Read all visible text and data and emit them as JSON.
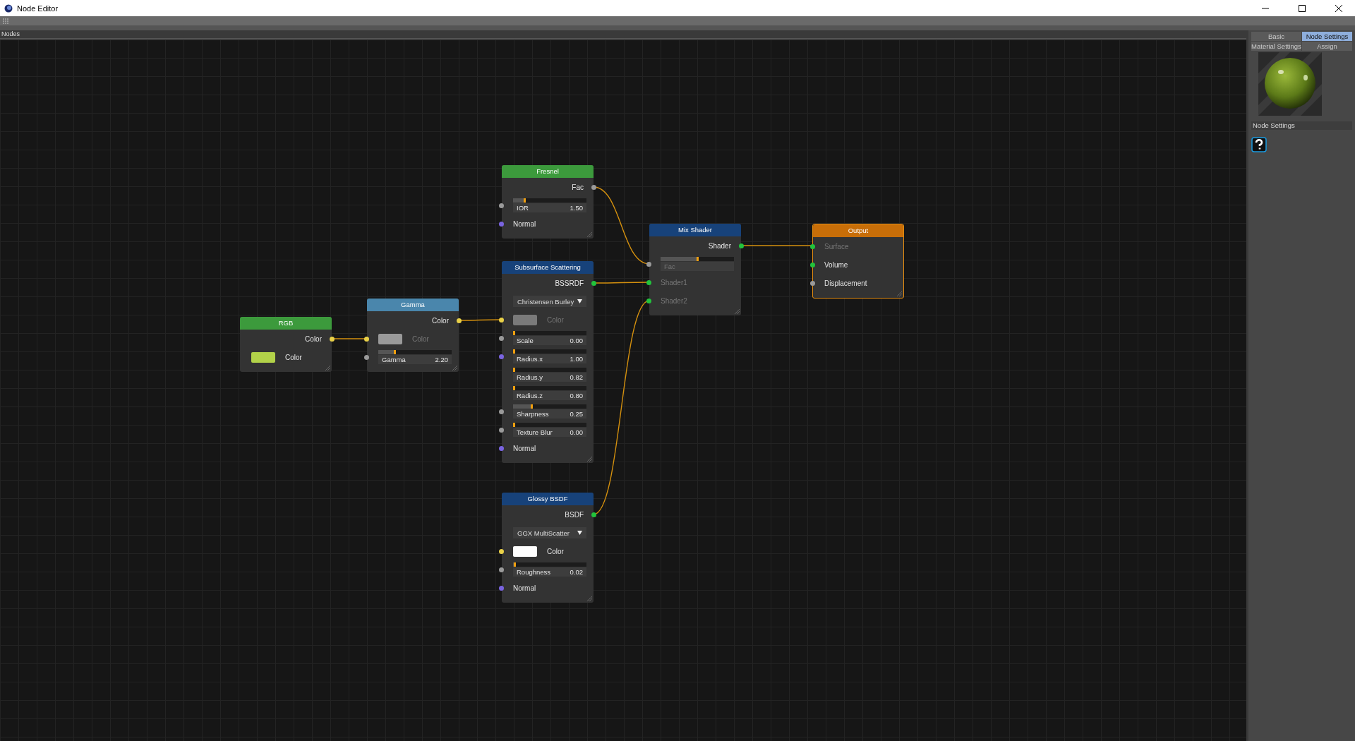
{
  "window": {
    "title": "Node Editor"
  },
  "editor": {
    "title": "Nodes"
  },
  "nodes": [
    {
      "title": "Fresnel",
      "kind": "input",
      "rows": [
        {
          "kind": "output",
          "label": "Fac",
          "socket": {
            "kind": "float"
          }
        },
        {
          "kind": "slider",
          "label": "IOR",
          "value": "1.50",
          "level": 0.15,
          "socket": {
            "kind": "float"
          },
          "connected": false
        },
        {
          "kind": "input",
          "label": "Normal",
          "socket": {
            "kind": "vector"
          },
          "connected": false
        }
      ]
    },
    {
      "title": "Mix Shader",
      "kind": "shader",
      "rows": [
        {
          "kind": "output",
          "label": "Shader",
          "socket": {
            "kind": "shader"
          }
        },
        {
          "kind": "slider",
          "label": "Fac",
          "level": 0.5,
          "socket": {
            "kind": "float"
          },
          "connected": true
        },
        {
          "kind": "input",
          "label": "Shader1",
          "socket": {
            "kind": "shader"
          },
          "connected": true
        },
        {
          "kind": "input",
          "label": "Shader2",
          "socket": {
            "kind": "shader"
          },
          "connected": true
        }
      ]
    },
    {
      "title": "Output",
      "kind": "output",
      "rows": [
        {
          "kind": "input",
          "label": "Surface",
          "socket": {
            "kind": "shader"
          },
          "connected": true
        },
        {
          "kind": "input",
          "label": "Volume",
          "socket": {
            "kind": "shader"
          },
          "connected": false
        },
        {
          "kind": "input",
          "label": "Displacement",
          "socket": {
            "kind": "float"
          },
          "connected": false
        }
      ]
    },
    {
      "title": "Subsurface Scattering",
      "kind": "shader",
      "rows": [
        {
          "kind": "output",
          "label": "BSSRDF",
          "socket": {
            "kind": "shader"
          }
        },
        {
          "kind": "dropdown",
          "value": "Christensen Burley"
        },
        {
          "kind": "color",
          "label": "Color",
          "color": "#7a7a7a",
          "socket": {
            "kind": "color"
          },
          "connected": true
        },
        {
          "kind": "slider",
          "label": "Scale",
          "value": "0.00",
          "level": 0,
          "socket": {
            "kind": "float"
          },
          "connected": false
        },
        {
          "kind": "slider",
          "label": "Radius.x",
          "value": "1.00",
          "level": 0,
          "socket": {
            "kind": "vector"
          },
          "connected": false
        },
        {
          "kind": "slider",
          "label": "Radius.y",
          "value": "0.82",
          "level": 0,
          "connected": false
        },
        {
          "kind": "slider",
          "label": "Radius.z",
          "value": "0.80",
          "level": 0,
          "connected": false
        },
        {
          "kind": "slider",
          "label": "Sharpness",
          "value": "0.25",
          "level": 0.25,
          "socket": {
            "kind": "float"
          },
          "connected": false
        },
        {
          "kind": "slider",
          "label": "Texture Blur",
          "value": "0.00",
          "level": 0,
          "socket": {
            "kind": "float"
          },
          "connected": false
        },
        {
          "kind": "input",
          "label": "Normal",
          "socket": {
            "kind": "vector"
          },
          "connected": false
        }
      ]
    },
    {
      "title": "RGB",
      "kind": "input",
      "rows": [
        {
          "kind": "output",
          "label": "Color",
          "socket": {
            "kind": "color"
          }
        },
        {
          "kind": "color",
          "label": "Color",
          "color": "#b2d249",
          "connected": false
        }
      ]
    },
    {
      "title": "Gamma",
      "kind": "converter",
      "rows": [
        {
          "kind": "output",
          "label": "Color",
          "socket": {
            "kind": "color"
          }
        },
        {
          "kind": "color",
          "label": "Color",
          "color": "#9a9a9a",
          "socket": {
            "kind": "color"
          },
          "connected": true
        },
        {
          "kind": "slider",
          "label": "Gamma",
          "value": "2.20",
          "level": 0.22,
          "socket": {
            "kind": "float"
          },
          "connected": false
        }
      ]
    },
    {
      "title": "Glossy BSDF",
      "kind": "shader",
      "rows": [
        {
          "kind": "output",
          "label": "BSDF",
          "socket": {
            "kind": "shader"
          }
        },
        {
          "kind": "dropdown",
          "value": "GGX MultiScatter"
        },
        {
          "kind": "color",
          "label": "Color",
          "color": "#ffffff",
          "socket": {
            "kind": "color"
          },
          "connected": false
        },
        {
          "kind": "slider",
          "label": "Roughness",
          "value": "0.02",
          "level": 0.02,
          "socket": {
            "kind": "float"
          },
          "connected": false
        },
        {
          "kind": "input",
          "label": "Normal",
          "socket": {
            "kind": "vector"
          },
          "connected": false
        }
      ]
    }
  ],
  "panel": {
    "tabs": [
      {
        "label": "Basic",
        "selected": false
      },
      {
        "label": "Node Settings",
        "selected": true
      },
      {
        "label": "Material Settings",
        "selected": false
      },
      {
        "label": "Assign",
        "selected": false
      }
    ],
    "section": "Node Settings"
  }
}
